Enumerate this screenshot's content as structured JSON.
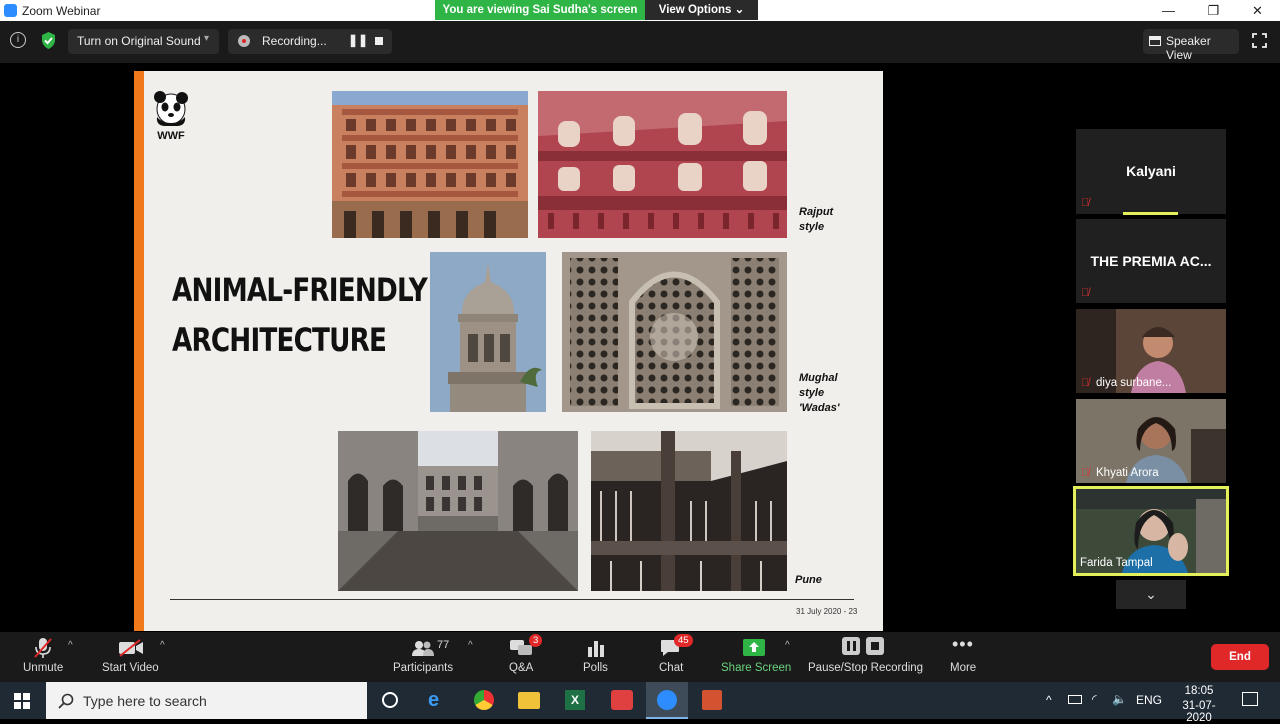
{
  "window": {
    "title": "Zoom Webinar",
    "minimize": "—",
    "maximize": "❐",
    "close": "✕"
  },
  "banner": {
    "viewing": "You are viewing Sai Sudha's screen",
    "view_options": "View Options"
  },
  "toolbar_top": {
    "original_sound": "Turn on Original Sound",
    "recording": "Recording...",
    "speaker_view": "Speaker View"
  },
  "slide": {
    "logo": "WWF",
    "title_line1": "ANIMAL-FRIENDLY",
    "title_line2": "ARCHITECTURE",
    "caption_rajput_1": "Rajput",
    "caption_rajput_2": "style",
    "caption_mughal_1": "Mughal",
    "caption_mughal_2": "style",
    "caption_mughal_3": "'Wadas'",
    "caption_pune": "Pune",
    "footer": "31 July 2020 - 23"
  },
  "participants": [
    {
      "name": "Kalyani",
      "type": "text"
    },
    {
      "name": "THE PREMIA AC...",
      "type": "text"
    },
    {
      "name": "diya surbane...",
      "type": "video"
    },
    {
      "name": "Khyati Arora",
      "type": "video"
    },
    {
      "name": "Farida Tampal",
      "type": "video"
    }
  ],
  "bottom_toolbar": {
    "unmute": "Unmute",
    "start_video": "Start Video",
    "participants": "Participants",
    "participants_count": "77",
    "qa": "Q&A",
    "qa_badge": "3",
    "polls": "Polls",
    "chat": "Chat",
    "chat_badge": "45",
    "share_screen": "Share Screen",
    "pause_stop": "Pause/Stop Recording",
    "more": "More",
    "end": "End"
  },
  "taskbar": {
    "search_placeholder": "Type here to search",
    "lang": "ENG",
    "time": "18:05",
    "date": "31-07-2020"
  },
  "colors": {
    "accent_green": "#2fb446",
    "orange_bar": "#f07a1a",
    "end_red": "#e02828",
    "active_tile_border": "#e3f05a"
  }
}
